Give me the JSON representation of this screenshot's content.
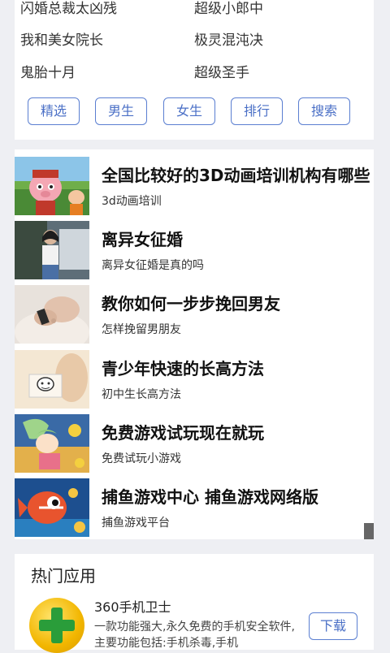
{
  "book_links": [
    [
      "闪婚总裁太凶残",
      "超级小郎中"
    ],
    [
      "我和美女院长",
      "极灵混沌决"
    ],
    [
      "鬼胎十月",
      "超级圣手"
    ]
  ],
  "nav_buttons": [
    "精选",
    "男生",
    "女生",
    "排行",
    "搜索"
  ],
  "ads": [
    {
      "title": "全国比较好的3D动画培训机构有哪些",
      "subtitle": "3d动画培训"
    },
    {
      "title": "离异女征婚",
      "subtitle": "离异女征婚是真的吗"
    },
    {
      "title": "教你如何一步步挽回男友",
      "subtitle": "怎样挽留男朋友"
    },
    {
      "title": "青少年快速的长高方法",
      "subtitle": "初中生长高方法"
    },
    {
      "title": "免费游戏试玩现在就玩",
      "subtitle": "免费试玩小游戏"
    },
    {
      "title": "捕鱼游戏中心 捕鱼游戏网络版",
      "subtitle": "捕鱼游戏平台"
    }
  ],
  "hot_apps": {
    "title": "热门应用",
    "app": {
      "name": "360手机卫士",
      "description": "一款功能强大,永久免费的手机安全软件,主要功能包括:手机杀毒,手机",
      "download_label": "下载",
      "icon": "360-guard-plus-icon"
    }
  },
  "colors": {
    "accent": "#4a6fc6",
    "background": "#eeeff3"
  }
}
